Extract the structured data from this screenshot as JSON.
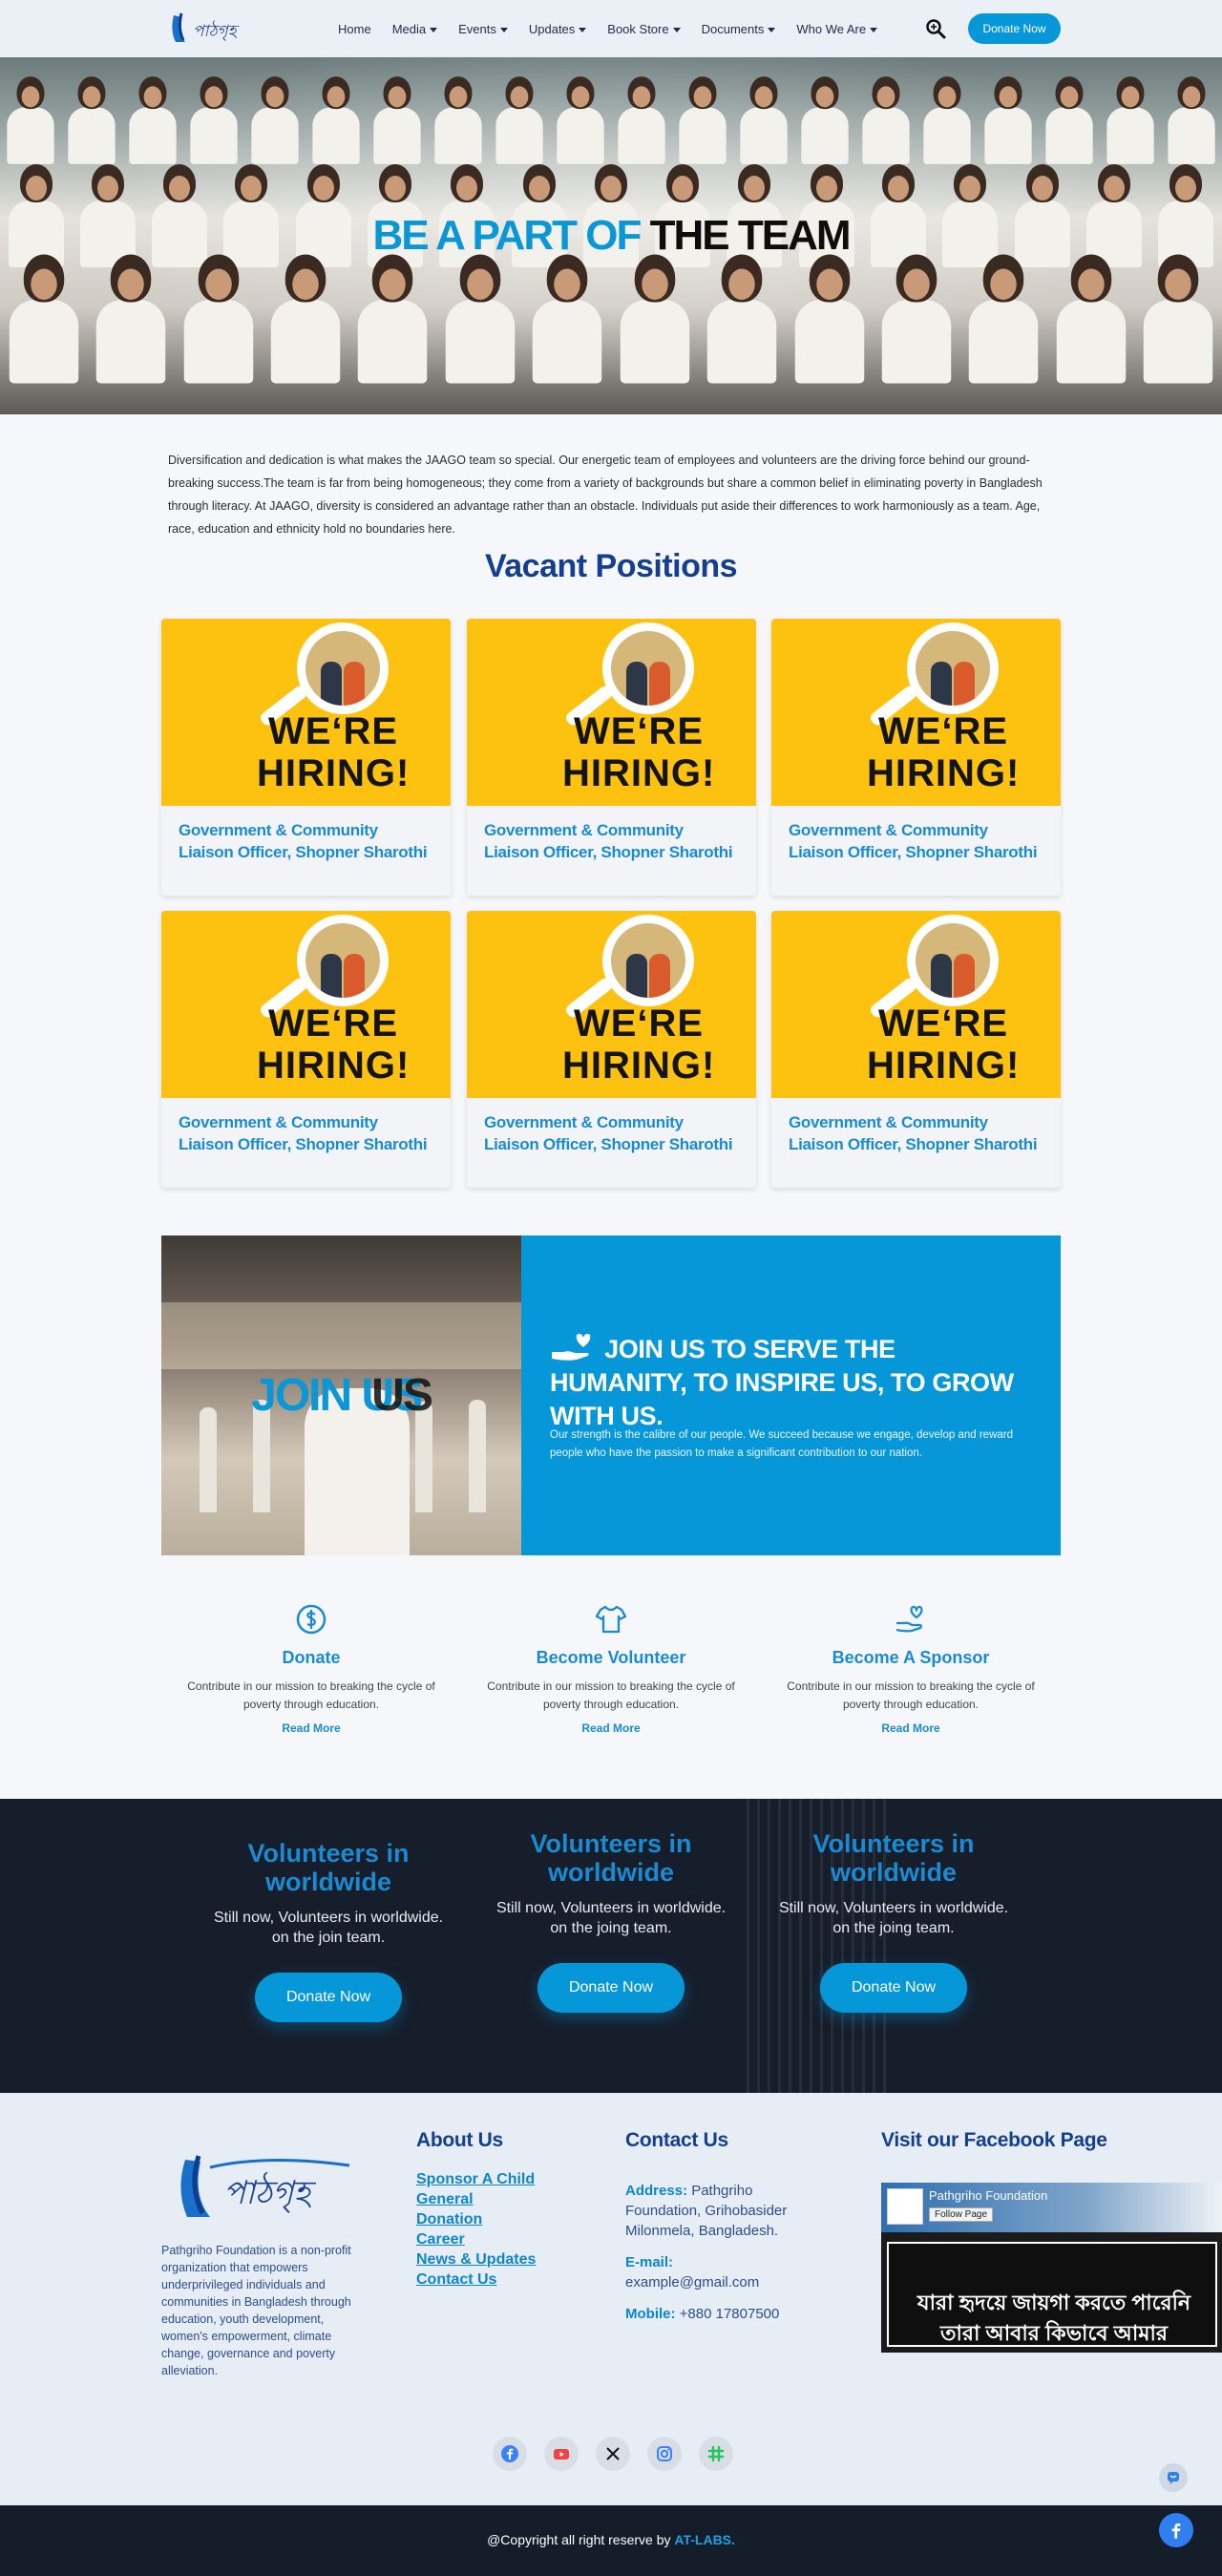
{
  "brand": {
    "logo_text": "পাঠগৃহ",
    "accent": "#0597d8",
    "navy": "#143e8e"
  },
  "nav": {
    "items": [
      {
        "label": "Home",
        "dropdown": false
      },
      {
        "label": "Media",
        "dropdown": true
      },
      {
        "label": "Events",
        "dropdown": true
      },
      {
        "label": "Updates",
        "dropdown": true
      },
      {
        "label": "Book Store",
        "dropdown": true
      },
      {
        "label": "Documents",
        "dropdown": true
      },
      {
        "label": "Who We Are",
        "dropdown": true
      }
    ],
    "search_icon": "search-icon",
    "donate_label": "Donate Now"
  },
  "hero": {
    "title_blue": "BE A PART OF",
    "title_dark": "THE TEAM"
  },
  "intro": "Diversification and dedication is what makes the JAAGO team so special. Our energetic team of employees and volunteers are the driving force behind our ground-breaking success.The team is far from being homogeneous; they come from a variety of backgrounds but share a common belief in eliminating poverty in Bangladesh through literacy. At JAAGO, diversity is considered an advantage rather than an obstacle. Individuals put aside their differences to work harmoniously as a team. Age, race, education and ethnicity hold no boundaries here.",
  "positions": {
    "title": "Vacant Positions",
    "image_text_1": "WE‘RE",
    "image_text_2": "HIRING!",
    "cards": [
      {
        "title": "Government & Community Liaison Officer, Shopner Sharothi"
      },
      {
        "title": "Government & Community Liaison Officer, Shopner Sharothi"
      },
      {
        "title": "Government & Community Liaison Officer, Shopner Sharothi"
      },
      {
        "title": "Government & Community Liaison Officer, Shopner Sharothi"
      },
      {
        "title": "Government & Community Liaison Officer, Shopner Sharothi"
      },
      {
        "title": "Government & Community Liaison Officer, Shopner Sharothi"
      }
    ]
  },
  "join": {
    "photo_word_blue": "JOIN US",
    "photo_word_dark": "US",
    "heading": "JOIN US TO SERVE THE HUMANITY, TO INSPIRE US, TO GROW WITH US.",
    "text": "Our strength is the calibre of our people. We succeed because we engage, develop and reward people who have the passion to make a significant contribution to our nation."
  },
  "actions": [
    {
      "icon": "dollar-icon",
      "title": "Donate",
      "text": "Contribute in our mission to breaking the cycle of poverty through education.",
      "link": "Read More"
    },
    {
      "icon": "shirt-icon",
      "title": "Become Volunteer",
      "text": "Contribute in our mission to breaking the cycle of poverty through education.",
      "link": "Read More"
    },
    {
      "icon": "hand-heart-icon",
      "title": "Become A Sponsor",
      "text": "Contribute in our mission to breaking the cycle of poverty through education.",
      "link": "Read More"
    }
  ],
  "stats": [
    {
      "title": "Volunteers in worldwide",
      "text": "Still now, Volunteers in worldwide. on the join team.",
      "button": "Donate Now"
    },
    {
      "title": "Volunteers in worldwide",
      "text": "Still now, Volunteers in worldwide. on the joing team.",
      "button": "Donate Now"
    },
    {
      "title": "Volunteers in worldwide",
      "text": "Still now, Volunteers in worldwide. on the joing team.",
      "button": "Donate Now"
    }
  ],
  "footer": {
    "about_text": "Pathgriho Foundation is a non-profit organization that empowers underprivileged individuals and communities in Bangladesh through education, youth development, women's empowerment, climate change, governance and poverty alleviation.",
    "about_heading": "About Us",
    "links": [
      "Sponsor A Child",
      "General",
      "Donation",
      "Career",
      "News & Updates",
      "Contact Us"
    ],
    "contact_heading": "Contact Us",
    "address_label": "Address:",
    "address": "Pathgriho Foundation, Grihobasider Milonmela, Bangladesh.",
    "email_label": "E-mail:",
    "email": "example@gmail.com",
    "mobile_label": "Mobile:",
    "mobile": "+880 17807500",
    "facebook_heading": "Visit our Facebook Page",
    "fb_page_name": "Pathgriho Foundation",
    "fb_follow": "Follow Page",
    "fb_banner_line1": "যারা হৃদয়ে জায়গা করতে পারেনি",
    "fb_banner_line2": "তারা আবার কিভাবে আমার",
    "socials": [
      "facebook-icon",
      "youtube-icon",
      "x-icon",
      "instagram-icon",
      "slack-icon"
    ]
  },
  "copyright": {
    "text": "@Copyright  all right reserve by ",
    "highlight": "AT-LABS."
  }
}
